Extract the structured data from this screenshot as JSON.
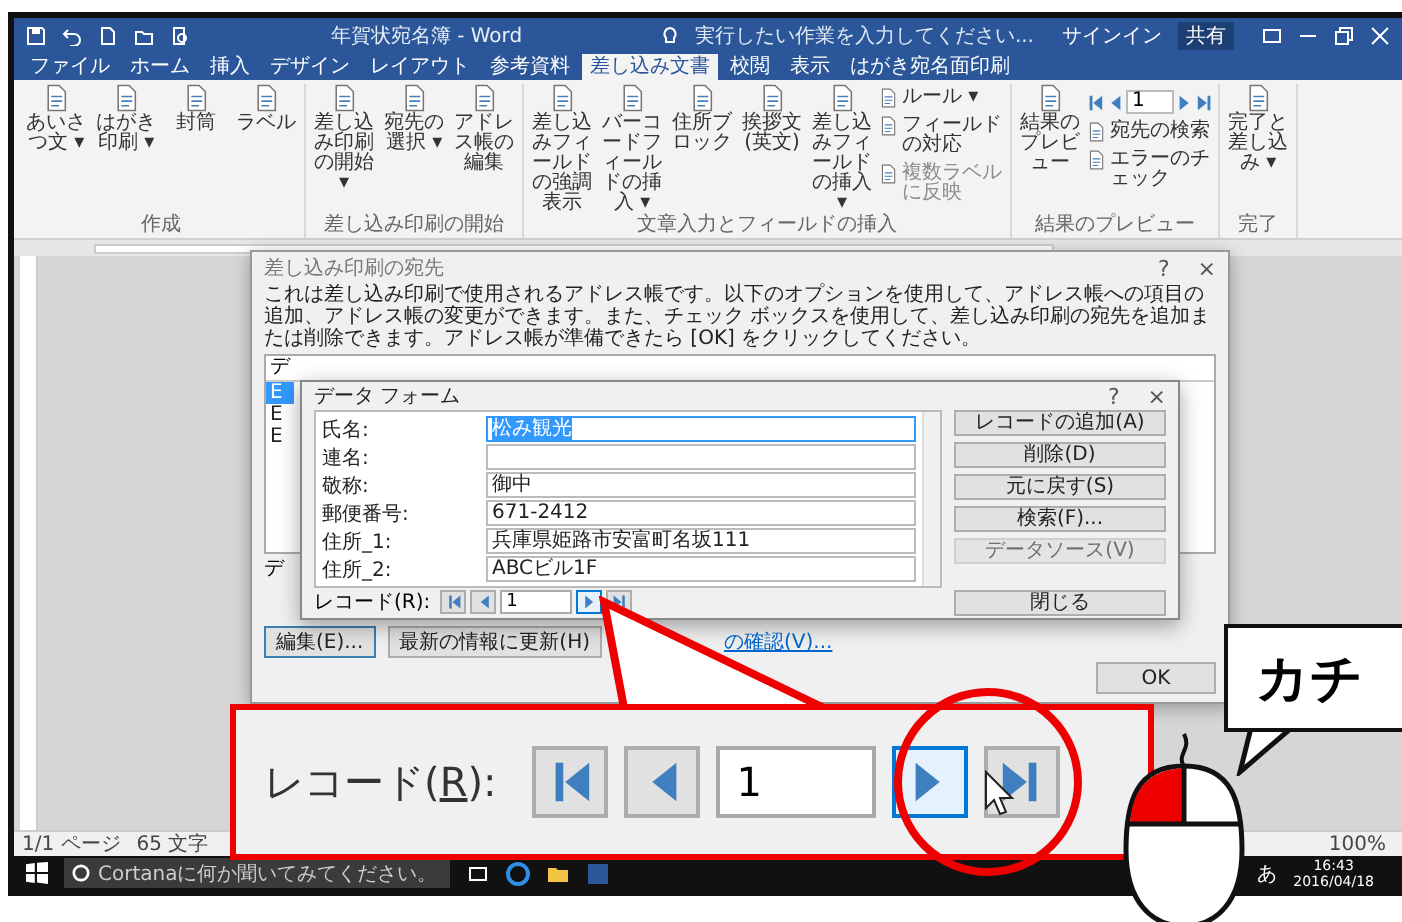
{
  "window": {
    "title": "年賀状宛名簿 - Word",
    "search_hint": "実行したい作業を入力してください...",
    "sign_in": "サインイン",
    "share": "共有"
  },
  "tabs": [
    {
      "label": "ファイル",
      "selected": false
    },
    {
      "label": "ホーム",
      "selected": false
    },
    {
      "label": "挿入",
      "selected": false
    },
    {
      "label": "デザイン",
      "selected": false
    },
    {
      "label": "レイアウト",
      "selected": false
    },
    {
      "label": "参考資料",
      "selected": false
    },
    {
      "label": "差し込み文書",
      "selected": true
    },
    {
      "label": "校閲",
      "selected": false
    },
    {
      "label": "表示",
      "selected": false
    },
    {
      "label": "はがき宛名面印刷",
      "selected": false
    }
  ],
  "ribbon_groups": [
    {
      "label": "作成",
      "items": [
        {
          "kind": "large",
          "label": "あいさつ文 ▾"
        },
        {
          "kind": "large",
          "label": "はがき印刷 ▾"
        },
        {
          "kind": "large",
          "label": "封筒"
        },
        {
          "kind": "large",
          "label": "ラベル"
        }
      ]
    },
    {
      "label": "差し込み印刷の開始",
      "items": [
        {
          "kind": "large",
          "label": "差し込み印刷の開始 ▾"
        },
        {
          "kind": "large",
          "label": "宛先の選択 ▾"
        },
        {
          "kind": "large",
          "label": "アドレス帳の編集"
        }
      ]
    },
    {
      "label": "文章入力とフィールドの挿入",
      "items": [
        {
          "kind": "large",
          "label": "差し込みフィールドの強調表示"
        },
        {
          "kind": "large",
          "label": "バーコードフィールドの挿入 ▾"
        },
        {
          "kind": "large",
          "label": "住所ブロック"
        },
        {
          "kind": "large",
          "label": "挨拶文 (英文)"
        },
        {
          "kind": "large",
          "label": "差し込みフィールドの挿入 ▾"
        },
        {
          "kind": "stack",
          "entries": [
            {
              "label": "ルール ▾",
              "disabled": false
            },
            {
              "label": "フィールドの対応",
              "disabled": false
            },
            {
              "label": "複数ラベルに反映",
              "disabled": true
            }
          ]
        }
      ]
    },
    {
      "label": "結果のプレビュー",
      "items": [
        {
          "kind": "large",
          "label": "結果のプレビュー"
        },
        {
          "kind": "nav",
          "value": "1",
          "entries": [
            {
              "label": "宛先の検索",
              "disabled": false
            },
            {
              "label": "エラーのチェック",
              "disabled": false
            }
          ]
        }
      ]
    },
    {
      "label": "完了",
      "items": [
        {
          "kind": "large",
          "label": "完了と差し込み ▾"
        }
      ]
    }
  ],
  "merge_dialog": {
    "title": "差し込み印刷の宛先",
    "help": "?",
    "close": "×",
    "description": "これは差し込み印刷で使用されるアドレス帳です。以下のオプションを使用して、アドレス帳への項目の追加、アドレス帳の変更ができます。また、チェック ボックスを使用して、差し込み印刷の宛先を追加または削除できます。アドレス帳が準備できたら [OK] をクリックしてください。",
    "list_header": "デ",
    "section_label": "デ",
    "list_rows": [
      {
        "text": "E",
        "selected": true
      },
      {
        "text": "E",
        "selected": false
      },
      {
        "text": "E",
        "selected": false
      }
    ],
    "buttons": [
      {
        "label": "編集(E)...",
        "focused": true
      },
      {
        "label": "最新の情報に更新(H)",
        "focused": false
      }
    ],
    "link": "の確認(V)...",
    "ok": "OK"
  },
  "data_form": {
    "title": "データ フォーム",
    "help": "?",
    "close": "×",
    "fields": [
      {
        "label": "氏名:",
        "value": "松み観光",
        "selected": true
      },
      {
        "label": "連名:",
        "selected": false
      },
      {
        "label": "敬称:",
        "value": "御中",
        "selected": false
      },
      {
        "label": "郵便番号:",
        "value": "671-2412",
        "selected": false
      },
      {
        "label": "住所_1:",
        "value": "兵庫県姫路市安富町名坂111",
        "selected": false
      },
      {
        "label": "住所_2:",
        "value": "ABCビル1F",
        "selected": false
      }
    ],
    "buttons": [
      {
        "label": "レコードの追加(A)",
        "disabled": false
      },
      {
        "label": "削除(D)",
        "disabled": false
      },
      {
        "label": "元に戻す(S)",
        "disabled": false
      },
      {
        "label": "検索(F)...",
        "disabled": false
      },
      {
        "label": "データソース(V)",
        "disabled": true
      }
    ],
    "record_label": "レコード(R):",
    "record_value": "1",
    "close_button": "閉じる",
    "nav_buttons": [
      {
        "kind": "first",
        "hovered": false
      },
      {
        "kind": "prev",
        "hovered": false
      },
      {
        "kind": "next",
        "hovered": true
      },
      {
        "kind": "last",
        "hovered": false
      }
    ]
  },
  "callout": {
    "label_before": "レコード(",
    "mnemonic": "R",
    "label_after": "):",
    "record_value": "1",
    "nav_buttons": [
      {
        "kind": "first",
        "hovered": false
      },
      {
        "kind": "prev",
        "hovered": false
      },
      {
        "kind": "next",
        "hovered": true
      },
      {
        "kind": "last",
        "hovered": false
      }
    ]
  },
  "bubble": {
    "text": "カチ"
  },
  "status_bar": {
    "page": "1/1 ページ",
    "words": "65 文字",
    "zoom": "100%"
  },
  "taskbar": {
    "search_hint": "Cortanaに何か聞いてみてください。",
    "ime": "あ",
    "time": "16:43",
    "date": "2016/04/18"
  }
}
